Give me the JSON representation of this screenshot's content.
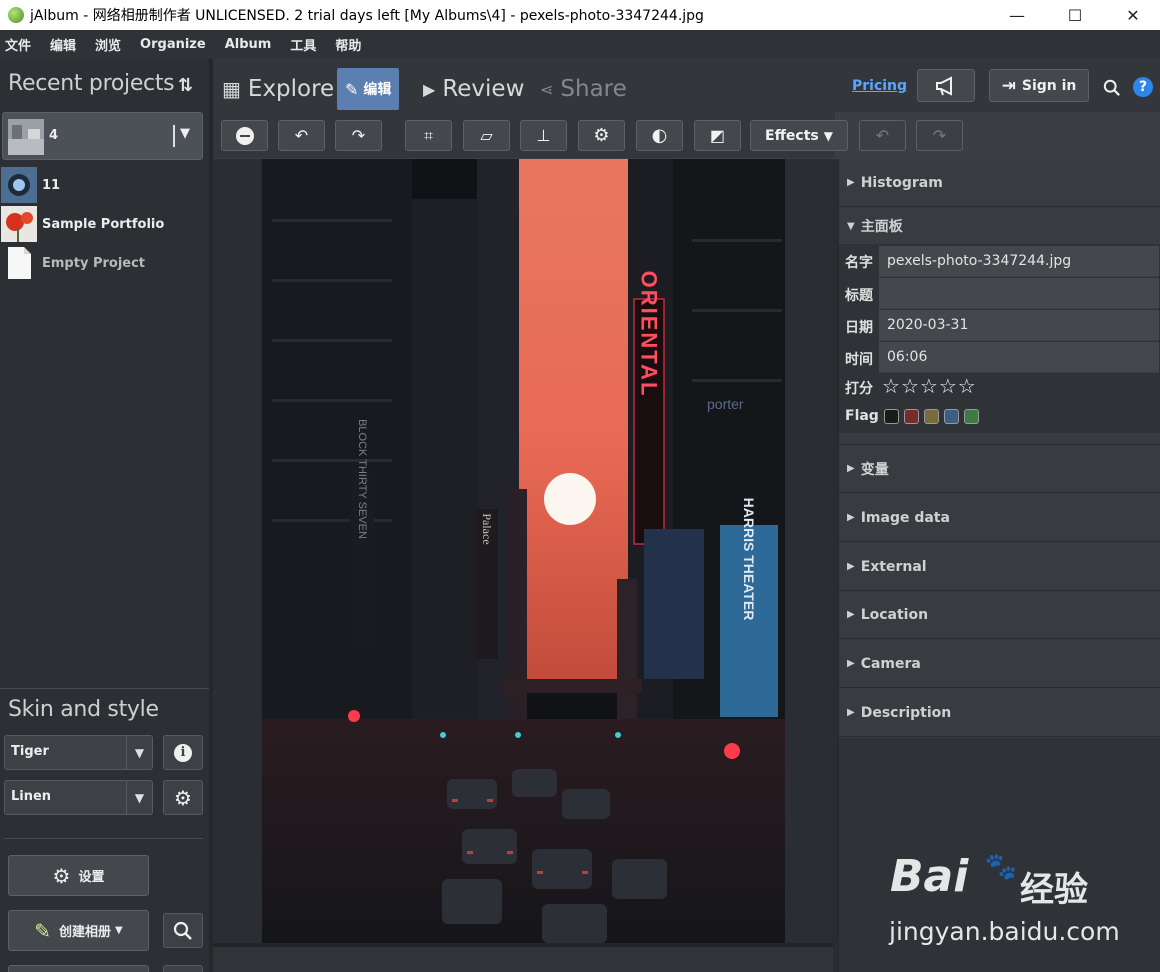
{
  "window": {
    "title": "jAlbum - 网络相册制作者 UNLICENSED. 2 trial days left [My Albums\\4] - pexels-photo-3347244.jpg",
    "controls": [
      "—",
      "☐",
      "✕"
    ]
  },
  "menu": [
    "文件",
    "编辑",
    "浏览",
    "Organize",
    "Album",
    "工具",
    "帮助"
  ],
  "left": {
    "recent_title": "Recent projects",
    "projects": [
      {
        "label": "4",
        "selected": true
      },
      {
        "label": "11"
      },
      {
        "label": "Sample Portfolio"
      },
      {
        "label": "Empty Project"
      }
    ],
    "skin_title": "Skin and style",
    "skin": "Tiger",
    "style": "Linen",
    "settings_label": "设置",
    "make_album_label": "创建相册"
  },
  "tabs": {
    "explore": "Explore",
    "edit": "编辑",
    "review": "Review",
    "share": "Share"
  },
  "header": {
    "pricing": "Pricing",
    "sign_in": "Sign in"
  },
  "edit_toolbar": {
    "effects": "Effects"
  },
  "right": {
    "histogram": "Histogram",
    "main_panel": "主面板",
    "labels": {
      "name": "名字",
      "title": "标题",
      "date": "日期",
      "time": "时间",
      "rating": "打分",
      "flag": "Flag"
    },
    "values": {
      "name": "pexels-photo-3347244.jpg",
      "title": "",
      "date": "2020-03-31",
      "time": "06:06"
    },
    "rating": 0,
    "flag_colors": [
      "#1b1b1b",
      "#7a2b2b",
      "#7a6a3c",
      "#3b5f82",
      "#3e7a45"
    ],
    "sections": [
      "变量",
      "Image data",
      "External",
      "Location",
      "Camera",
      "Description"
    ]
  },
  "photo_signs": {
    "oriental": "ORIENTAL",
    "palace": "Palace",
    "block": "BLOCK THIRTY SEVEN",
    "harris": "HARRIS THEATER",
    "porter": "porter"
  },
  "watermark": {
    "brand": "Bai",
    "brand_cn": "经验",
    "url": "jingyan.baidu.com"
  }
}
